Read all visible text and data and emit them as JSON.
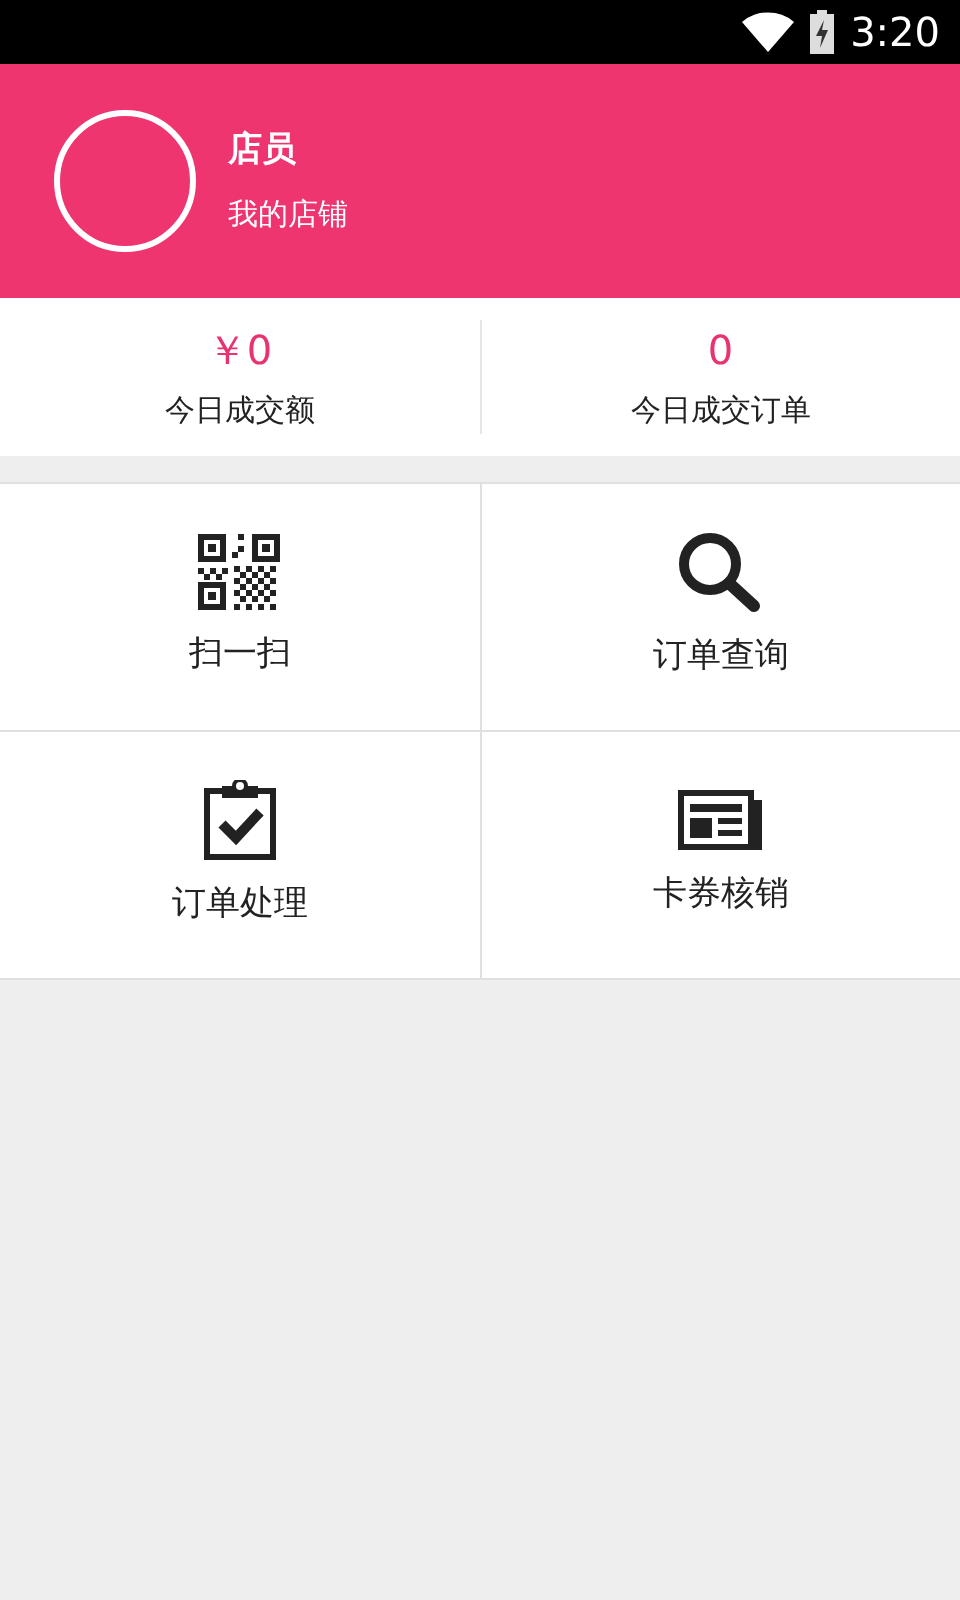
{
  "status_bar": {
    "time": "3:20"
  },
  "profile": {
    "name": "店员",
    "shop": "我的店铺"
  },
  "stats": [
    {
      "value": "￥0",
      "label": "今日成交额"
    },
    {
      "value": "0",
      "label": "今日成交订单"
    }
  ],
  "tiles": [
    {
      "kind": "qr",
      "label": "扫一扫"
    },
    {
      "kind": "search",
      "label": "订单查询"
    },
    {
      "kind": "clipboard",
      "label": "订单处理"
    },
    {
      "kind": "news",
      "label": "卡券核销"
    }
  ]
}
